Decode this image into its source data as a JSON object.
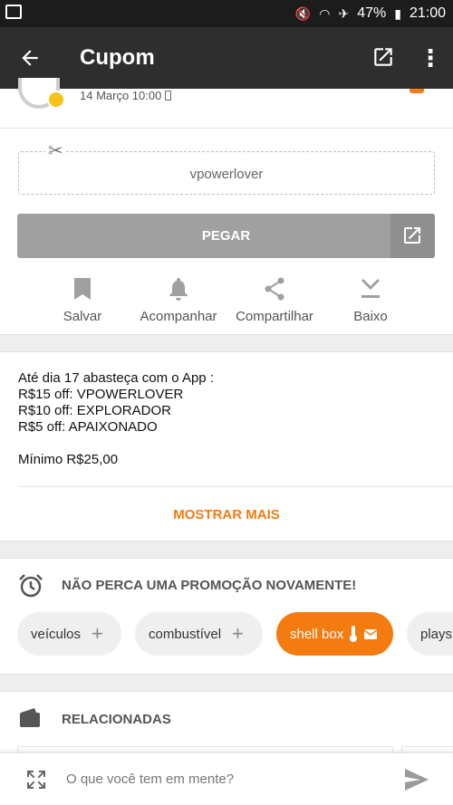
{
  "status_bar": {
    "battery": "47%",
    "time": "21:00"
  },
  "app_bar": {
    "title": "Cupom",
    "icons": [
      "back-arrow-icon",
      "open-external-icon",
      "more-vert-icon"
    ]
  },
  "post": {
    "date": "14 Março 10:00"
  },
  "coupon": {
    "code": "vpowerlover",
    "button_label": "PEGAR"
  },
  "actions": [
    {
      "label": "Salvar",
      "icon": "bookmark-icon"
    },
    {
      "label": "Acompanhar",
      "icon": "bell-icon"
    },
    {
      "label": "Compartilhar",
      "icon": "share-icon"
    },
    {
      "label": "Baixo",
      "icon": "download-icon"
    }
  ],
  "description": {
    "lines": [
      "Até  dia 17 abasteça com o App :",
      "R$15 off: VPOWERLOVER",
      "R$10 off: EXPLORADOR",
      "R$5 off: APAIXONADO",
      "",
      "Mínimo R$25,00"
    ],
    "more_label": "MOSTRAR MAIS"
  },
  "alerts": {
    "heading": "NÃO PERCA UMA PROMOÇÃO NOVAMENTE!",
    "chips": [
      {
        "label": "veículos",
        "active": false
      },
      {
        "label": "combustível",
        "active": false
      },
      {
        "label": "shell box",
        "active": true
      },
      {
        "label": "plays",
        "active": false
      }
    ]
  },
  "related": {
    "heading": "RELACIONADAS"
  },
  "composer": {
    "placeholder": "O que você tem em mente?"
  },
  "colors": {
    "accent": "#f37b10",
    "appbar": "#2e2e2e",
    "statusbar": "#1c1c1c",
    "button_gray": "#a0a0a0"
  }
}
